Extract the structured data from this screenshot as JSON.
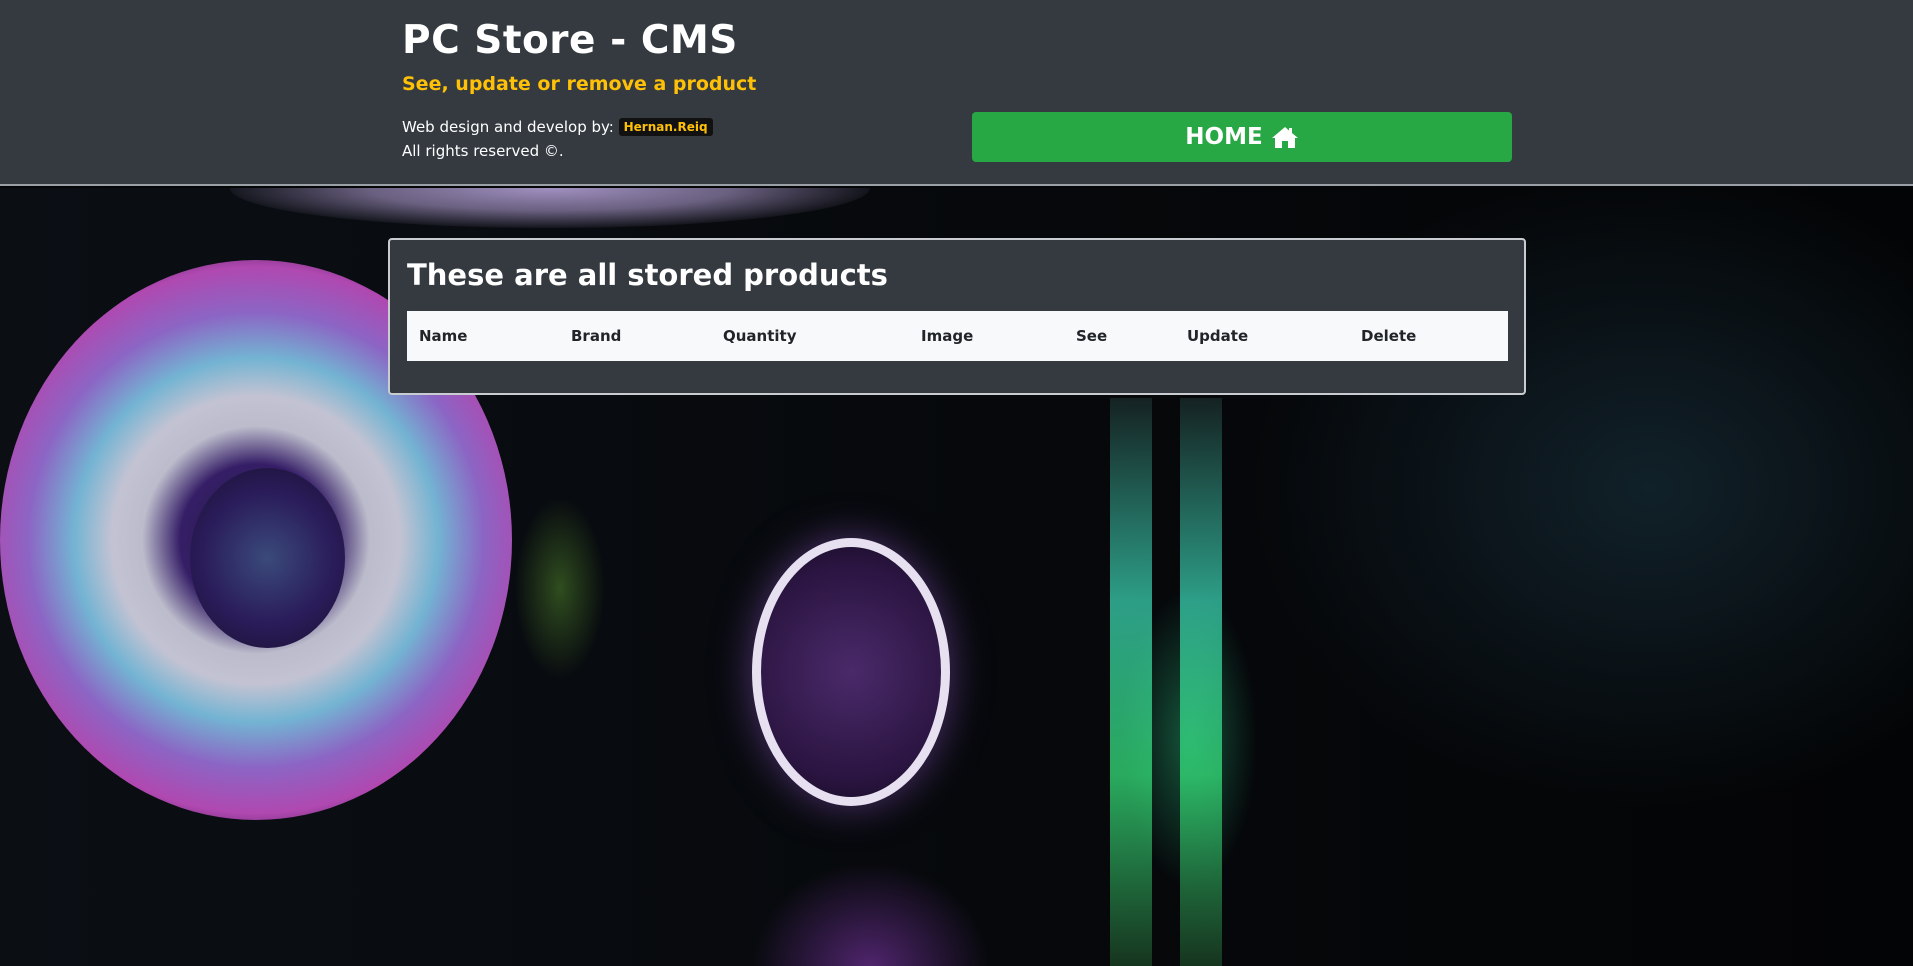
{
  "header": {
    "title": "PC Store - CMS",
    "subtitle": "See, update or remove a product",
    "credits_prefix": "Web design and develop by:",
    "author": "Hernan.Reiq",
    "rights": "All rights reserved ©.",
    "home_label": "HOME",
    "home_icon": "home-icon"
  },
  "panel": {
    "title": "These are all stored products",
    "columns": [
      "Name",
      "Brand",
      "Quantity",
      "Image",
      "See",
      "Update",
      "Delete"
    ],
    "rows": []
  },
  "colors": {
    "header_bg": "#343a40",
    "subtitle": "#ffc107",
    "home_button": "#28a745",
    "table_header_bg": "#f8f9fa"
  }
}
